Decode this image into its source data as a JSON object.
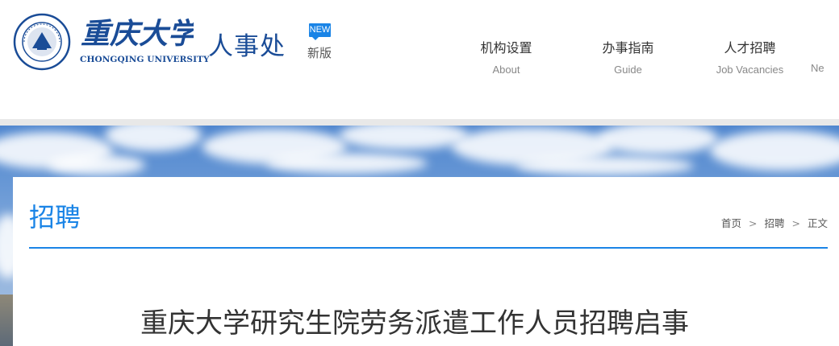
{
  "header": {
    "logo_cn": "重庆大学",
    "logo_en": "CHONGQING UNIVERSITY",
    "dept": "人事处",
    "new_badge": "NEW",
    "new_version": "新版"
  },
  "nav": {
    "items": [
      {
        "cn": "机构设置",
        "en": "About"
      },
      {
        "cn": "办事指南",
        "en": "Guide"
      },
      {
        "cn": "人才招聘",
        "en": "Job Vacancies"
      },
      {
        "cn": "",
        "en": "Ne"
      }
    ]
  },
  "section": {
    "title": "招聘",
    "breadcrumb": [
      "首页",
      "招聘",
      "正文"
    ],
    "breadcrumb_sep": ">"
  },
  "article": {
    "title": "重庆大学研究生院劳务派遣工作人员招聘启事"
  },
  "colors": {
    "brand_blue": "#1a4c97",
    "accent_blue": "#1a84e6"
  }
}
